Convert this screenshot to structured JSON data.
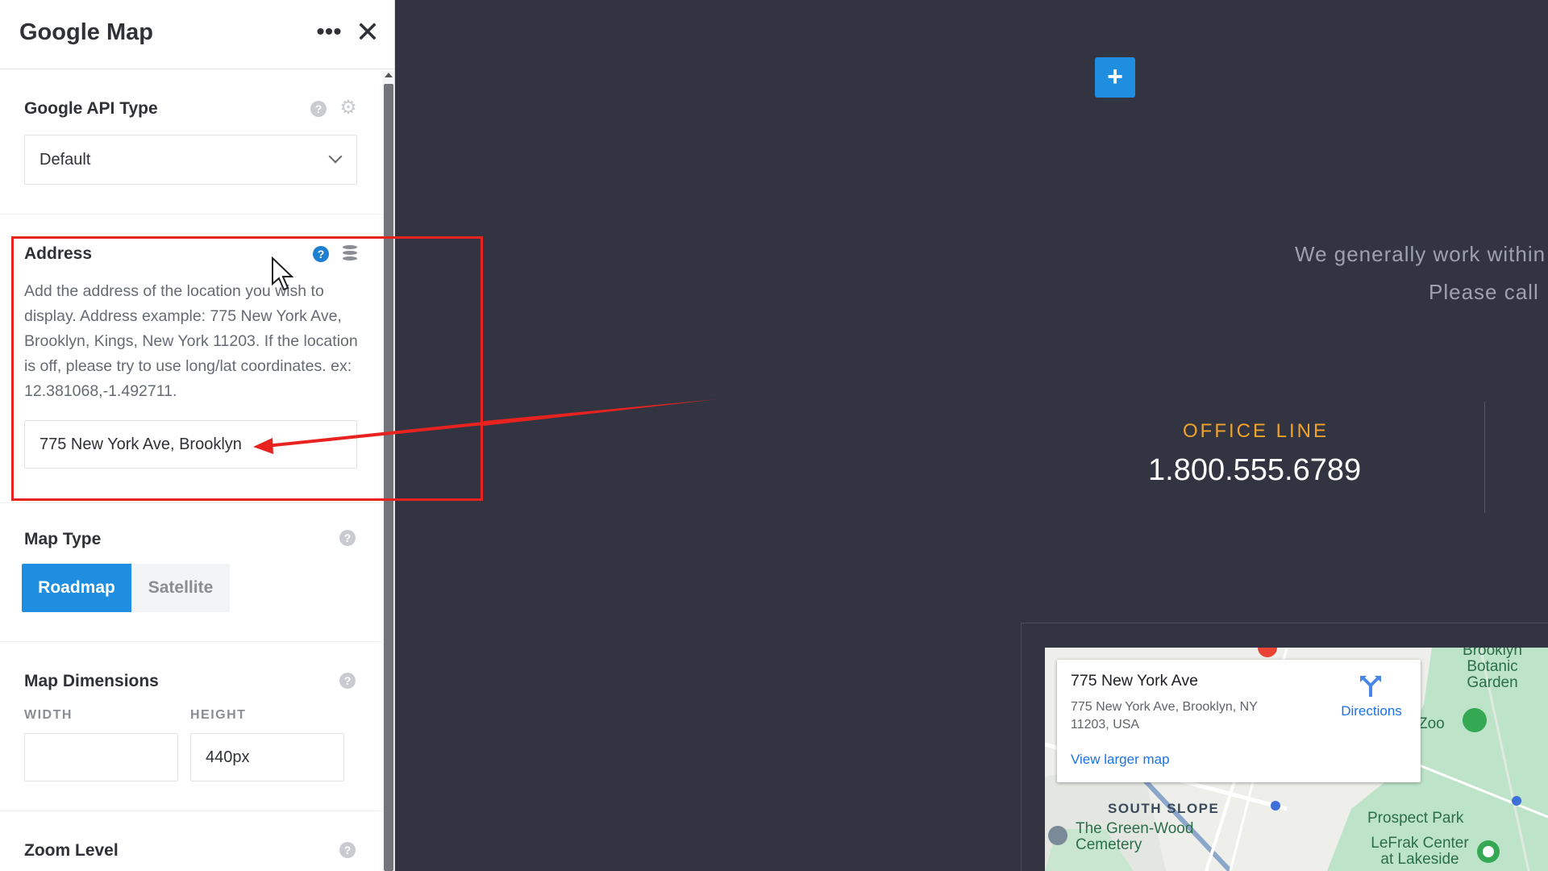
{
  "panel": {
    "title": "Google Map",
    "api_type": {
      "label": "Google API Type",
      "selected": "Default"
    },
    "address": {
      "label": "Address",
      "description": "Add the address of the location you wish to display. Address example: 775 New York Ave, Brooklyn, Kings, New York 11203. If the location is off, please try to use long/lat coordinates. ex: 12.381068,-1.492711.",
      "value": "775 New York Ave, Brooklyn"
    },
    "map_type": {
      "label": "Map Type",
      "options": [
        "Roadmap",
        "Satellite"
      ],
      "selected": "Roadmap"
    },
    "map_dimensions": {
      "label": "Map Dimensions",
      "width_label": "WIDTH",
      "height_label": "HEIGHT",
      "width_value": "",
      "height_value": "440px"
    },
    "zoom": {
      "label": "Zoom Level"
    }
  },
  "preview": {
    "hero_line1": "We generally work within",
    "hero_line2": "Please call",
    "office_label": "OFFICE LINE",
    "office_number": "1.800.555.6789",
    "map": {
      "place_title": "775 New York Ave",
      "place_address": "775 New York Ave, Brooklyn, NY 11203, USA",
      "directions_label": "Directions",
      "larger_map_link": "View larger map",
      "labels": {
        "botanic": "Brooklyn Botanic Garden",
        "zoo": "Zoo",
        "south_slope": "SOUTH SLOPE",
        "green_wood": "The Green-Wood Cemetery",
        "prospect_park": "Prospect Park",
        "lefrak": "LeFrak Center at Lakeside"
      }
    }
  },
  "colors": {
    "accent_blue": "#1f8de0",
    "highlight_red": "#e8231f",
    "office_orange": "#f0a32a",
    "canvas_bg": "#323442"
  },
  "icons": [
    "more-options-icon",
    "close-icon",
    "help-icon",
    "gear-icon",
    "database-icon",
    "chevron-down-icon",
    "plus-icon",
    "directions-icon",
    "cursor-icon"
  ]
}
